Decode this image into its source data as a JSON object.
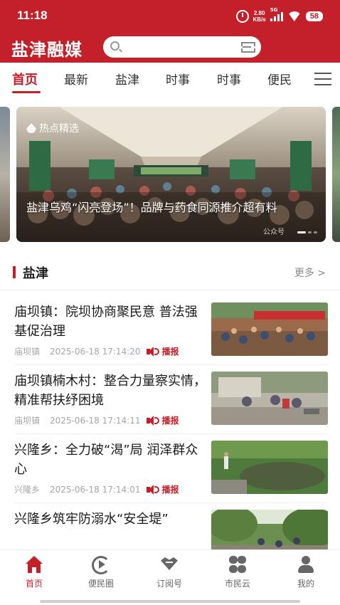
{
  "status_bar": {
    "time": "11:18",
    "net_speed_value": "2.80",
    "net_speed_unit": "KB/s",
    "signal_label": "5G",
    "battery": "58"
  },
  "header": {
    "app_title": "盐津融媒",
    "search_placeholder": ""
  },
  "tabs": [
    {
      "label": "首页",
      "active": true
    },
    {
      "label": "最新",
      "active": false
    },
    {
      "label": "盐津",
      "active": false
    },
    {
      "label": "时事",
      "active": false
    },
    {
      "label": "时事",
      "active": false
    },
    {
      "label": "便民",
      "active": false
    }
  ],
  "banner": {
    "tag": "热点精选",
    "caption": "盐津乌鸡“闪亮登场”！品牌与药食同源推介超有料",
    "source": "公众号"
  },
  "section": {
    "title": "盐津",
    "more": "更多 >"
  },
  "news": [
    {
      "title": "庙坝镇：院坝协商聚民意 普法强基促治理",
      "source": "庙坝镇",
      "time": "2025-06-18 17:14:20",
      "play": "播报"
    },
    {
      "title": "庙坝镇楠木村：整合力量察实情，精准帮扶纾困境",
      "source": "庙坝镇",
      "time": "2025-06-18 17:14:11",
      "play": "播报"
    },
    {
      "title": "兴隆乡：全力破“渴”局 润泽群众心",
      "source": "兴隆乡",
      "time": "2025-06-18 17:14:01",
      "play": "播报"
    },
    {
      "title": "兴隆乡筑牢防溺水“安全堤”",
      "source": "",
      "time": "",
      "play": ""
    }
  ],
  "bottom_nav": [
    {
      "label": "首页",
      "icon": "home-icon",
      "active": true
    },
    {
      "label": "便民圈",
      "icon": "play-circle-icon",
      "active": false
    },
    {
      "label": "订阅号",
      "icon": "heart-icon",
      "active": false
    },
    {
      "label": "市民云",
      "icon": "cloud-icon",
      "active": false
    },
    {
      "label": "我的",
      "icon": "user-icon",
      "active": false
    }
  ],
  "colors": {
    "brand_red": "#c4202a",
    "meta_gray": "#a6a6a6"
  }
}
